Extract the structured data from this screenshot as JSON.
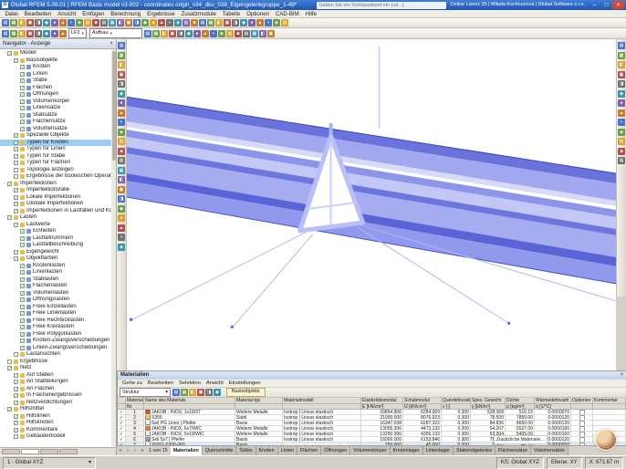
{
  "window": {
    "title": "Dlubal RFEM 5.09.01 | RFEM Basis model v3-002 - coordinates origin_v34_dku_038_Eigengelenkgruppe_1-49*",
    "search_placeholder": "Geben Sie ein Schlüsselwort ein (od...)",
    "license": "Online Lizenz 25 | Milada Kochounová | Dlubal Software s.r.o.",
    "controls": [
      "–",
      "□",
      "×"
    ]
  },
  "menu": {
    "items": [
      "Datei",
      "Bearbeiten",
      "Ansicht",
      "Einfügen",
      "Berechnung",
      "Ergebnisse",
      "Zusatzmodule",
      "Tabelle",
      "Optionen",
      "CAD-BIM",
      "Hilfe"
    ]
  },
  "colors": {
    "accent": "#1f55b0",
    "selection": "#9ecef5",
    "deck_main": "#a6acf0",
    "deck_dark": "#5a64d6",
    "deck_light": "#c3c7f5",
    "icon_palette": [
      "#4a72c8",
      "#6a9e4f",
      "#d9a12e",
      "#b35050",
      "#6f6f6f",
      "#3a96ae",
      "#7d62b0",
      "#c87a2e"
    ]
  },
  "toolbar_main": {
    "icons": [
      "new",
      "open",
      "save",
      "print",
      "undo",
      "redo",
      "copy",
      "paste",
      "delete",
      "zoom-window",
      "zoom-in",
      "zoom-out",
      "zoom-all",
      "previous-view",
      "isometric-view",
      "view-in-x",
      "view-in-y",
      "view-in-z",
      "perspective",
      "wireframe-render",
      "solid-render",
      "show-numbering",
      "show-loads",
      "show-supports",
      "show-results",
      "new-node",
      "new-line",
      "new-member",
      "new-surface",
      "new-opening",
      "dimension",
      "comment",
      "tables-toggle",
      "navigator-toggle",
      "panel-toggle"
    ]
  },
  "toolbar_second": {
    "icons_left": [
      "edit-mode",
      "select-mode",
      "special-selection",
      "visibility",
      "user-defined-view",
      "snap-settings",
      "work-plane",
      "previous-load-case"
    ],
    "load_case": "LF2",
    "load_case_desc": "Aufbau",
    "icons_right": [
      "next-load-case",
      "calculate-all",
      "calculation-parameters",
      "results-toggle",
      "deformed-shape",
      "member-forces",
      "surface-stresses",
      "support-reactions",
      "load-display",
      "numbering-display",
      "text-labels",
      "render-mode",
      "light-settings",
      "clipping-plane",
      "measure",
      "print-graphic"
    ]
  },
  "left_toolbar": {
    "icons": [
      "select-pointer",
      "zoom-box",
      "pan-view",
      "rotate-view",
      "zoom-all",
      "previous-zoom",
      "new-node",
      "new-line",
      "new-arc",
      "new-member",
      "new-surface",
      "new-solid",
      "new-opening",
      "nodal-support",
      "line-support",
      "member-hinge",
      "nodal-load",
      "line-load",
      "member-load",
      "surface-load",
      "dimension-tool",
      "comment-tool"
    ]
  },
  "right_toolbar": {
    "icons": [
      "full-view",
      "section-view",
      "visibility-mode",
      "x-view",
      "y-view",
      "z-view",
      "isometric",
      "orbit",
      "zoom-mode",
      "pan-mode",
      "render-toggle",
      "shadow-toggle",
      "background-settings"
    ]
  },
  "navigator": {
    "title": "Navigator - Anzeige",
    "tabs": [
      "daten",
      "zeigen",
      "ansichten",
      "ergebnisse"
    ],
    "tree": [
      {
        "l": "Modell",
        "v": 0,
        "c": true
      },
      {
        "l": "Basisobjekte",
        "v": 1,
        "c": true
      },
      {
        "l": "Knoten",
        "v": 2,
        "c": true
      },
      {
        "l": "Linien",
        "v": 2,
        "c": true
      },
      {
        "l": "Stäbe",
        "v": 2,
        "c": true
      },
      {
        "l": "Flächen",
        "v": 2,
        "c": true
      },
      {
        "l": "Öffnungen",
        "v": 2,
        "c": true
      },
      {
        "l": "Volumenkörper",
        "v": 2,
        "c": true
      },
      {
        "l": "Liniensätze",
        "v": 2,
        "c": true
      },
      {
        "l": "Stabsätze",
        "v": 2,
        "c": true
      },
      {
        "l": "Flächensätze",
        "v": 2,
        "c": true
      },
      {
        "l": "Volumensätze",
        "v": 2,
        "c": true
      },
      {
        "l": "Spezielle Objekte",
        "v": 1,
        "c": true
      },
      {
        "l": "Typen für Knoten",
        "v": 1,
        "c": true,
        "s": true
      },
      {
        "l": "Typen für Linien",
        "v": 1,
        "c": true
      },
      {
        "l": "Typen für Stäbe",
        "v": 1,
        "c": true
      },
      {
        "l": "Typen für Flächen",
        "v": 1,
        "c": true
      },
      {
        "l": "Topologie anzeigen",
        "v": 1,
        "c": false
      },
      {
        "l": "Ergebnisse der booleschen Operationen",
        "v": 1,
        "c": false
      },
      {
        "l": "Imperfektionen",
        "v": 0,
        "c": true
      },
      {
        "l": "Imperfektionsfälle",
        "v": 1,
        "c": true
      },
      {
        "l": "Lokale Imperfektionen",
        "v": 1,
        "c": true
      },
      {
        "l": "Globale Imperfektionen",
        "v": 1,
        "c": true
      },
      {
        "l": "Imperfektionen in Lastfällen und Kombina...",
        "v": 1,
        "c": true
      },
      {
        "l": "Lasten",
        "v": 0,
        "c": true
      },
      {
        "l": "Lastwerte",
        "v": 1,
        "c": true
      },
      {
        "l": "Einheiten",
        "v": 2,
        "c": true
      },
      {
        "l": "Lastfallnummern",
        "v": 2,
        "c": true
      },
      {
        "l": "Lastfallbeschreibung",
        "v": 2,
        "c": true
      },
      {
        "l": "Eigengewicht",
        "v": 1,
        "c": true
      },
      {
        "l": "Objektfarben",
        "v": 1,
        "c": true
      },
      {
        "l": "Knotenlasten",
        "v": 2,
        "c": true
      },
      {
        "l": "Linienlasten",
        "v": 2,
        "c": true
      },
      {
        "l": "Stablasten",
        "v": 2,
        "c": true
      },
      {
        "l": "Flächenlasten",
        "v": 2,
        "c": true
      },
      {
        "l": "Volumenlasten",
        "v": 2,
        "c": true
      },
      {
        "l": "Öffnungslasten",
        "v": 2,
        "c": true
      },
      {
        "l": "Freie Einzellasten",
        "v": 2,
        "c": true
      },
      {
        "l": "Freie Linienlasten",
        "v": 2,
        "c": true
      },
      {
        "l": "Freie Rechtecklasten",
        "v": 2,
        "c": true
      },
      {
        "l": "Freie Kreislasten",
        "v": 2,
        "c": true
      },
      {
        "l": "Freie Polygonlasten",
        "v": 2,
        "c": true
      },
      {
        "l": "Knoten-Zwangsverschiebungen",
        "v": 2,
        "c": true
      },
      {
        "l": "Linien-Zwangsverschiebungen",
        "v": 2,
        "c": true
      },
      {
        "l": "Lastansichten",
        "v": 1,
        "c": false
      },
      {
        "l": "Ergebnisse",
        "v": 0,
        "c": false
      },
      {
        "l": "Netz",
        "v": 0,
        "c": true
      },
      {
        "l": "Auf Stäben",
        "v": 1,
        "c": true
      },
      {
        "l": "An Stabteilungen",
        "v": 1,
        "c": true
      },
      {
        "l": "An Flächen",
        "v": 1,
        "c": true
      },
      {
        "l": "In Flächenergebnissen",
        "v": 1,
        "c": true
      },
      {
        "l": "Netzverdichtungen",
        "v": 1,
        "c": true
      },
      {
        "l": "Hilfsmittel",
        "v": 0,
        "c": true
      },
      {
        "l": "Hilfslinien",
        "v": 1,
        "c": true
      },
      {
        "l": "Hilfsknoten",
        "v": 1,
        "c": true
      },
      {
        "l": "Kommentare",
        "v": 1,
        "c": true
      },
      {
        "l": "Gebäudemodell",
        "v": 1,
        "c": false
      }
    ]
  },
  "materials": {
    "title": "Materialien",
    "menu": [
      "Gehe zu",
      "Bearbeiten",
      "Selektion",
      "Ansicht",
      "Einstellungen"
    ],
    "structure_combo": "Struktur",
    "active_tab": "Basisobjekte",
    "header_row1": [
      "",
      "Material",
      "Name des Materials",
      "Material-typ",
      "Materialmodell",
      "Elastizitätsmodul",
      "Schubmodul",
      "Querdehnzahl",
      "Spez. Gewicht",
      "Dichte",
      "Wärmedehnzahl",
      "Optionen",
      "Kommentar"
    ],
    "header_row2": [
      "",
      "Nr.",
      "",
      "",
      "",
      "E [kN/cm²]",
      "G [kN/cm²]",
      "ν [-]",
      "γ [kN/m³]",
      "ρ [kg/m³]",
      "α [1/°C]",
      "",
      ""
    ],
    "rows": [
      {
        "nr": "1",
        "color": "#d94f2b",
        "name": "JAKOB - INOX, 1x19/37",
        "typ": "Weitere Metalle",
        "modell": "Isotrop | Linear elastisch",
        "e": "10854.906",
        "g": "6284.969",
        "nu": "0.300",
        "gamma": "528.368",
        "rho": "510.15",
        "alpha": "0.0000070",
        "selected": false
      },
      {
        "nr": "2",
        "color": "#e8d44d",
        "name": "S355",
        "typ": "Stahl",
        "modell": "Isotrop | Linear elastisch",
        "e": "21000.000",
        "g": "8076.923",
        "nu": "0.300",
        "gamma": "78.500",
        "rho": "7850.00",
        "alpha": "0.0000120",
        "selected": false
      },
      {
        "nr": "3",
        "color": "#f2f2f2",
        "name": "Seil PG Linex | Pfeifer",
        "typ": "Basis",
        "modell": "Isotrop | Linear elastisch",
        "e": "16347.038",
        "g": "6287.322",
        "nu": "0.300",
        "gamma": "84.836",
        "rho": "8650.00",
        "alpha": "0.0000120",
        "selected": false
      },
      {
        "nr": "4",
        "color": "#e07b39",
        "name": "JAKOB - INOX, 6x7/WIC",
        "typ": "Weitere Metalle",
        "modell": "Isotrop | Linear elastisch",
        "e": "13055.396",
        "g": "4473.132",
        "nu": "0.300",
        "gamma": "54.207",
        "rho": "5527.00",
        "alpha": "0.0000160",
        "selected": false
      },
      {
        "nr": "5",
        "color": "#f2f2f2",
        "name": "JAKOB - INOX, 6x19/WIC",
        "typ": "Weitere Metalle",
        "modell": "Isotrop | Linear elastisch",
        "e": "13250.396",
        "g": "4355.132",
        "nu": "0.300",
        "gamma": "53.004",
        "rho": "5405.00",
        "alpha": "0.0000160",
        "selected": false
      },
      {
        "nr": "6",
        "color": "#9a9a9a",
        "name": "Seil 5x7 | Pfeifer",
        "typ": "Basis",
        "modell": "Isotrop | Linear elastisch",
        "e": "16000.000",
        "g": "6153.846",
        "nu": "0.300",
        "gamma": "78.500",
        "rho": "8005.00",
        "alpha": "0.0000120",
        "selected": false
      },
      {
        "nr": "7",
        "color": "#f2f2f2",
        "name": "20261-0200-060",
        "typ": "Basis",
        "modell": "Orthotrop | Linear elastisch (Flä...",
        "e": "750.000",
        "g": "45.000",
        "nu": "0.200",
        "gamma": "5.000",
        "rho": "46.20",
        "alpha": "0.0000050",
        "selected": true
      }
    ],
    "pager": {
      "label": "1 von 15",
      "buttons": [
        "«",
        "‹",
        "›",
        "»"
      ]
    },
    "tabs": [
      "Materialien",
      "Querschnitte",
      "Stäbe",
      "Knoten",
      "Linien",
      "Flächen",
      "Öffnungen",
      "Volumenkörper",
      "Knotenlager",
      "Linienlager",
      "Stabendgelenke",
      "Flächensätze",
      "Volumensätze"
    ],
    "note": "Zusätzliche Materialei..."
  },
  "status": {
    "left": "1 - Global XYZ",
    "ks": "KS: Global XYZ",
    "plane": "Ebene: XY",
    "coords": "X: 671.67 m"
  }
}
